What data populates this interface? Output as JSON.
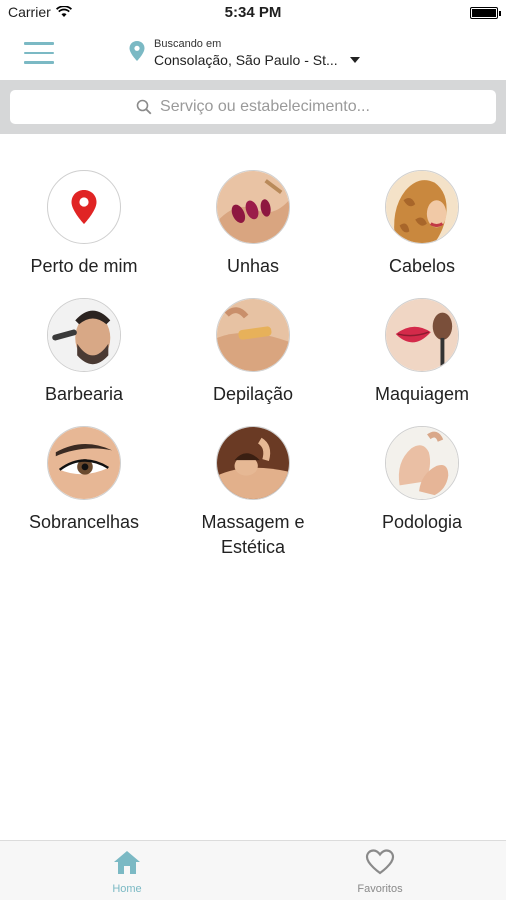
{
  "status_bar": {
    "carrier": "Carrier",
    "time": "5:34 PM"
  },
  "header": {
    "location_label": "Buscando em",
    "location_value": "Consolação, São Paulo - St..."
  },
  "search": {
    "placeholder": "Serviço ou estabelecimento..."
  },
  "categories": [
    {
      "label": "Perto de mim",
      "icon": "location-pin-icon"
    },
    {
      "label": "Unhas",
      "icon": "nails-photo"
    },
    {
      "label": "Cabelos",
      "icon": "hair-photo"
    },
    {
      "label": "Barbearia",
      "icon": "barber-photo"
    },
    {
      "label": "Depilação",
      "icon": "waxing-photo"
    },
    {
      "label": "Maquiagem",
      "icon": "makeup-photo"
    },
    {
      "label": "Sobrancelhas",
      "icon": "eyebrow-photo"
    },
    {
      "label": "Massagem e Estética",
      "icon": "massage-photo"
    },
    {
      "label": "Podologia",
      "icon": "feet-photo"
    }
  ],
  "tab_bar": {
    "home_label": "Home",
    "favorites_label": "Favoritos",
    "active_color": "#7bb9c4",
    "inactive_color": "#8a8a8a"
  },
  "colors": {
    "accent": "#7bb9c4",
    "pin_red": "#e02424",
    "search_band": "#d6d7d8"
  }
}
